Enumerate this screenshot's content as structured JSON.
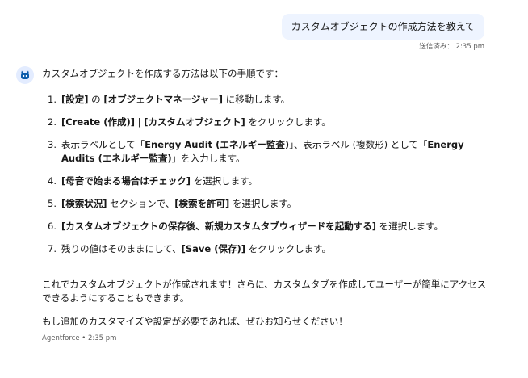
{
  "user_message": {
    "text": "カスタムオブジェクトの作成方法を教えて",
    "status": "送信済み： 2:35 pm"
  },
  "agent_message": {
    "avatar_icon": "agentforce-robot-icon",
    "intro": "カスタムオブジェクトを作成する方法は以下の手順です：",
    "steps": [
      {
        "num": "1.",
        "parts": [
          {
            "b": true,
            "t": "[設定]"
          },
          {
            "b": false,
            "t": " の "
          },
          {
            "b": true,
            "t": "[オブジェクトマネージャー]"
          },
          {
            "b": false,
            "t": " に移動します。"
          }
        ]
      },
      {
        "num": "2.",
        "parts": [
          {
            "b": true,
            "t": "[Create (作成)]"
          },
          {
            "b": false,
            "t": " | "
          },
          {
            "b": true,
            "t": "[カスタムオブジェクト]"
          },
          {
            "b": false,
            "t": " をクリックします。"
          }
        ]
      },
      {
        "num": "3.",
        "parts": [
          {
            "b": false,
            "t": "表示ラベルとして「"
          },
          {
            "b": true,
            "t": "Energy Audit (エネルギー監査)"
          },
          {
            "b": false,
            "t": "」、表示ラベル (複数形) として「"
          },
          {
            "b": true,
            "t": "Energy Audits (エネルギー監査)"
          },
          {
            "b": false,
            "t": "」を入力します。"
          }
        ]
      },
      {
        "num": "4.",
        "parts": [
          {
            "b": true,
            "t": "[母音で始まる場合はチェック]"
          },
          {
            "b": false,
            "t": " を選択します。"
          }
        ]
      },
      {
        "num": "5.",
        "parts": [
          {
            "b": true,
            "t": "[検索状況]"
          },
          {
            "b": false,
            "t": " セクションで、"
          },
          {
            "b": true,
            "t": "[検索を許可]"
          },
          {
            "b": false,
            "t": " を選択します。"
          }
        ]
      },
      {
        "num": "6.",
        "parts": [
          {
            "b": true,
            "t": "[カスタムオブジェクトの保存後、新規カスタムタブウィザードを起動する]"
          },
          {
            "b": false,
            "t": " を選択します。"
          }
        ]
      },
      {
        "num": "7.",
        "parts": [
          {
            "b": false,
            "t": "残りの値はそのままにして、"
          },
          {
            "b": true,
            "t": "[Save (保存)]"
          },
          {
            "b": false,
            "t": " をクリックします。"
          }
        ]
      }
    ],
    "closing1": "これでカスタムオブジェクトが作成されます！さらに、カスタムタブを作成してユーザーが簡単にアクセスできるようにすることもできます。",
    "closing2": "もし追加のカスタマイズや設定が必要であれば、ぜひお知らせください！",
    "meta": "Agentforce • 2:35 pm"
  },
  "colors": {
    "user_bubble": "#eef4ff",
    "avatar_bg": "#e3ecff",
    "avatar_fg": "#0b5cab",
    "meta_text": "#5c5c5c"
  }
}
